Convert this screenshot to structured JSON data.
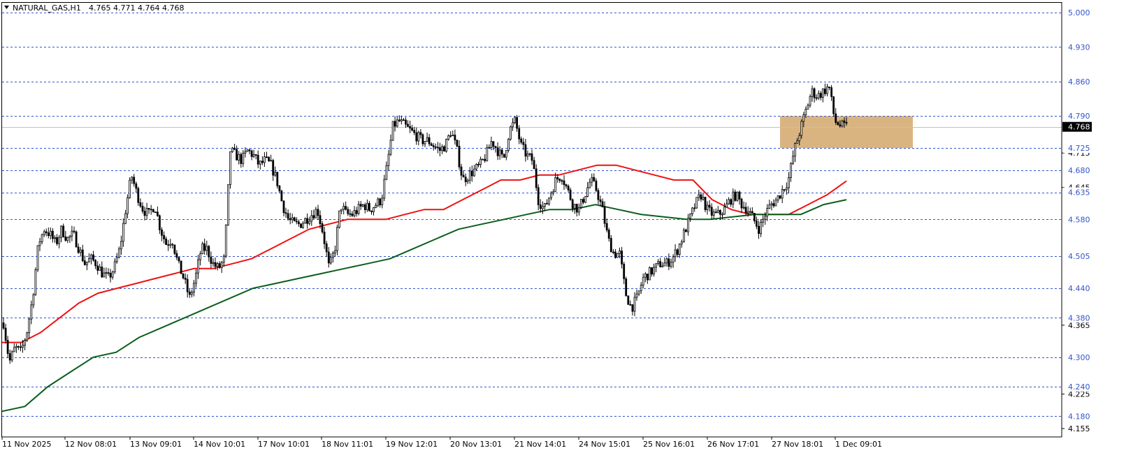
{
  "header": {
    "symbol_label": "NATURAL_GAS,H1",
    "ohlc": "4.765 4.771 4.764 4.768"
  },
  "chart_data": {
    "type": "candlestick",
    "symbol": "NATURAL_GAS",
    "timeframe": "H1",
    "ohlc_current": {
      "open": 4.765,
      "high": 4.771,
      "low": 4.764,
      "close": 4.768
    },
    "current_price_label": "4.768",
    "y_axis_range": [
      4.138,
      5.02
    ],
    "level_lines": [
      "5.000",
      "4.930",
      "4.860",
      "4.790",
      "4.725",
      "4.680",
      "4.635",
      "4.580",
      "4.505",
      "4.440",
      "4.380",
      "4.300",
      "4.240",
      "4.180"
    ],
    "minor_tick_labels": [
      "4.715",
      "4.645",
      "4.365",
      "4.225",
      "4.155"
    ],
    "x_tick_labels": [
      "11 Nov 2025",
      "12 Nov 08:01",
      "13 Nov 09:01",
      "14 Nov 10:01",
      "17 Nov 10:01",
      "18 Nov 11:01",
      "19 Nov 12:01",
      "20 Nov 13:01",
      "21 Nov 14:01",
      "24 Nov 15:01",
      "25 Nov 16:01",
      "26 Nov 17:01",
      "27 Nov 18:01",
      "1 Dec 09:01"
    ],
    "price_path": [
      4.37,
      4.29,
      4.32,
      4.31,
      4.35,
      4.42,
      4.53,
      4.56,
      4.55,
      4.53,
      4.56,
      4.54,
      4.55,
      4.52,
      4.49,
      4.5,
      4.49,
      4.47,
      4.46,
      4.48,
      4.52,
      4.6,
      4.67,
      4.63,
      4.6,
      4.59,
      4.61,
      4.56,
      4.53,
      4.54,
      4.49,
      4.46,
      4.42,
      4.46,
      4.52,
      4.52,
      4.49,
      4.48,
      4.5,
      4.72,
      4.71,
      4.7,
      4.72,
      4.71,
      4.69,
      4.7,
      4.69,
      4.66,
      4.61,
      4.58,
      4.57,
      4.57,
      4.58,
      4.59,
      4.6,
      4.55,
      4.48,
      4.52,
      4.61,
      4.59,
      4.59,
      4.6,
      4.61,
      4.6,
      4.61,
      4.62,
      4.69,
      4.77,
      4.78,
      4.77,
      4.76,
      4.75,
      4.74,
      4.74,
      4.73,
      4.72,
      4.73,
      4.76,
      4.72,
      4.66,
      4.67,
      4.68,
      4.69,
      4.71,
      4.74,
      4.72,
      4.7,
      4.76,
      4.78,
      4.73,
      4.71,
      4.7,
      4.62,
      4.6,
      4.63,
      4.66,
      4.67,
      4.64,
      4.61,
      4.6,
      4.63,
      4.66,
      4.64,
      4.6,
      4.54,
      4.51,
      4.51,
      4.43,
      4.4,
      4.42,
      4.46,
      4.47,
      4.48,
      4.49,
      4.49,
      4.5,
      4.52,
      4.55,
      4.58,
      4.61,
      4.63,
      4.6,
      4.59,
      4.59,
      4.6,
      4.62,
      4.63,
      4.61,
      4.6,
      4.58,
      4.56,
      4.59,
      4.61,
      4.62,
      4.64,
      4.66,
      4.72,
      4.76,
      4.8,
      4.84,
      4.83,
      4.84,
      4.85,
      4.78,
      4.77,
      4.768
    ],
    "moving_averages": [
      {
        "color": "#ee1111",
        "values": [
          4.33,
          4.33,
          4.35,
          4.38,
          4.41,
          4.43,
          4.44,
          4.45,
          4.46,
          4.47,
          4.48,
          4.48,
          4.49,
          4.5,
          4.52,
          4.54,
          4.56,
          4.57,
          4.58,
          4.58,
          4.58,
          4.59,
          4.6,
          4.6,
          4.62,
          4.64,
          4.66,
          4.66,
          4.67,
          4.67,
          4.68,
          4.69,
          4.69,
          4.68,
          4.67,
          4.66,
          4.66,
          4.62,
          4.6,
          4.59,
          4.59,
          4.59,
          4.61,
          4.63,
          4.658
        ]
      },
      {
        "color": "#0b5e1c",
        "values": [
          4.19,
          4.2,
          4.24,
          4.27,
          4.3,
          4.31,
          4.34,
          4.36,
          4.38,
          4.4,
          4.42,
          4.44,
          4.45,
          4.46,
          4.47,
          4.48,
          4.49,
          4.5,
          4.52,
          4.54,
          4.56,
          4.57,
          4.58,
          4.59,
          4.6,
          4.6,
          4.61,
          4.6,
          4.59,
          4.585,
          4.58,
          4.58,
          4.585,
          4.59,
          4.59,
          4.59,
          4.61,
          4.62
        ]
      }
    ],
    "highlight_zone": {
      "from_price": 4.725,
      "to_price": 4.79,
      "color": "#d4a76a"
    },
    "colors": {
      "grid": "#3355cc",
      "price_line": "#c0c0c0",
      "candle": "#000000",
      "label_bg": "#000000",
      "label_text": "#ffffff"
    }
  }
}
